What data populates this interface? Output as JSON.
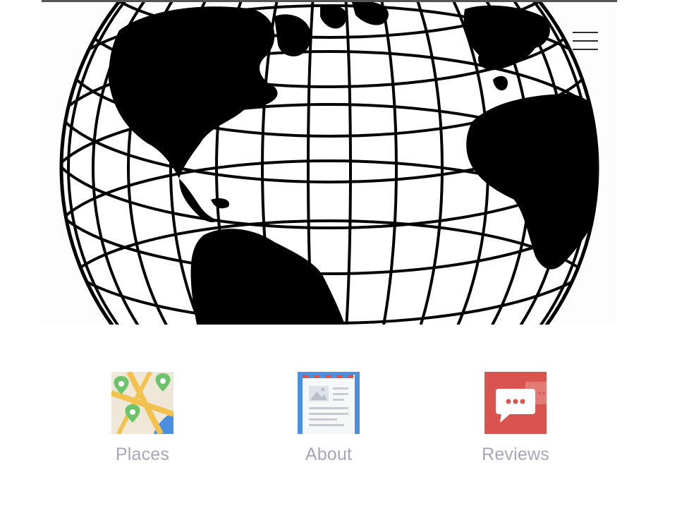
{
  "header": {
    "menu_icon": "hamburger-menu-icon",
    "hero_image": "globe-illustration"
  },
  "nav": {
    "items": [
      {
        "label": "Places",
        "icon": "map-pins-icon"
      },
      {
        "label": "About",
        "icon": "document-icon"
      },
      {
        "label": "Reviews",
        "icon": "chat-bubble-icon"
      }
    ]
  },
  "colors": {
    "label_text": "#a5a6ba",
    "places_tile_bg": "#efe8d8",
    "places_road": "#f2c14e",
    "places_pin": "#6cc36a",
    "places_water": "#4a90e2",
    "about_tile_border": "#4a90e2",
    "about_stripe_red": "#d9534f",
    "reviews_tile_bg": "#d9534f"
  }
}
